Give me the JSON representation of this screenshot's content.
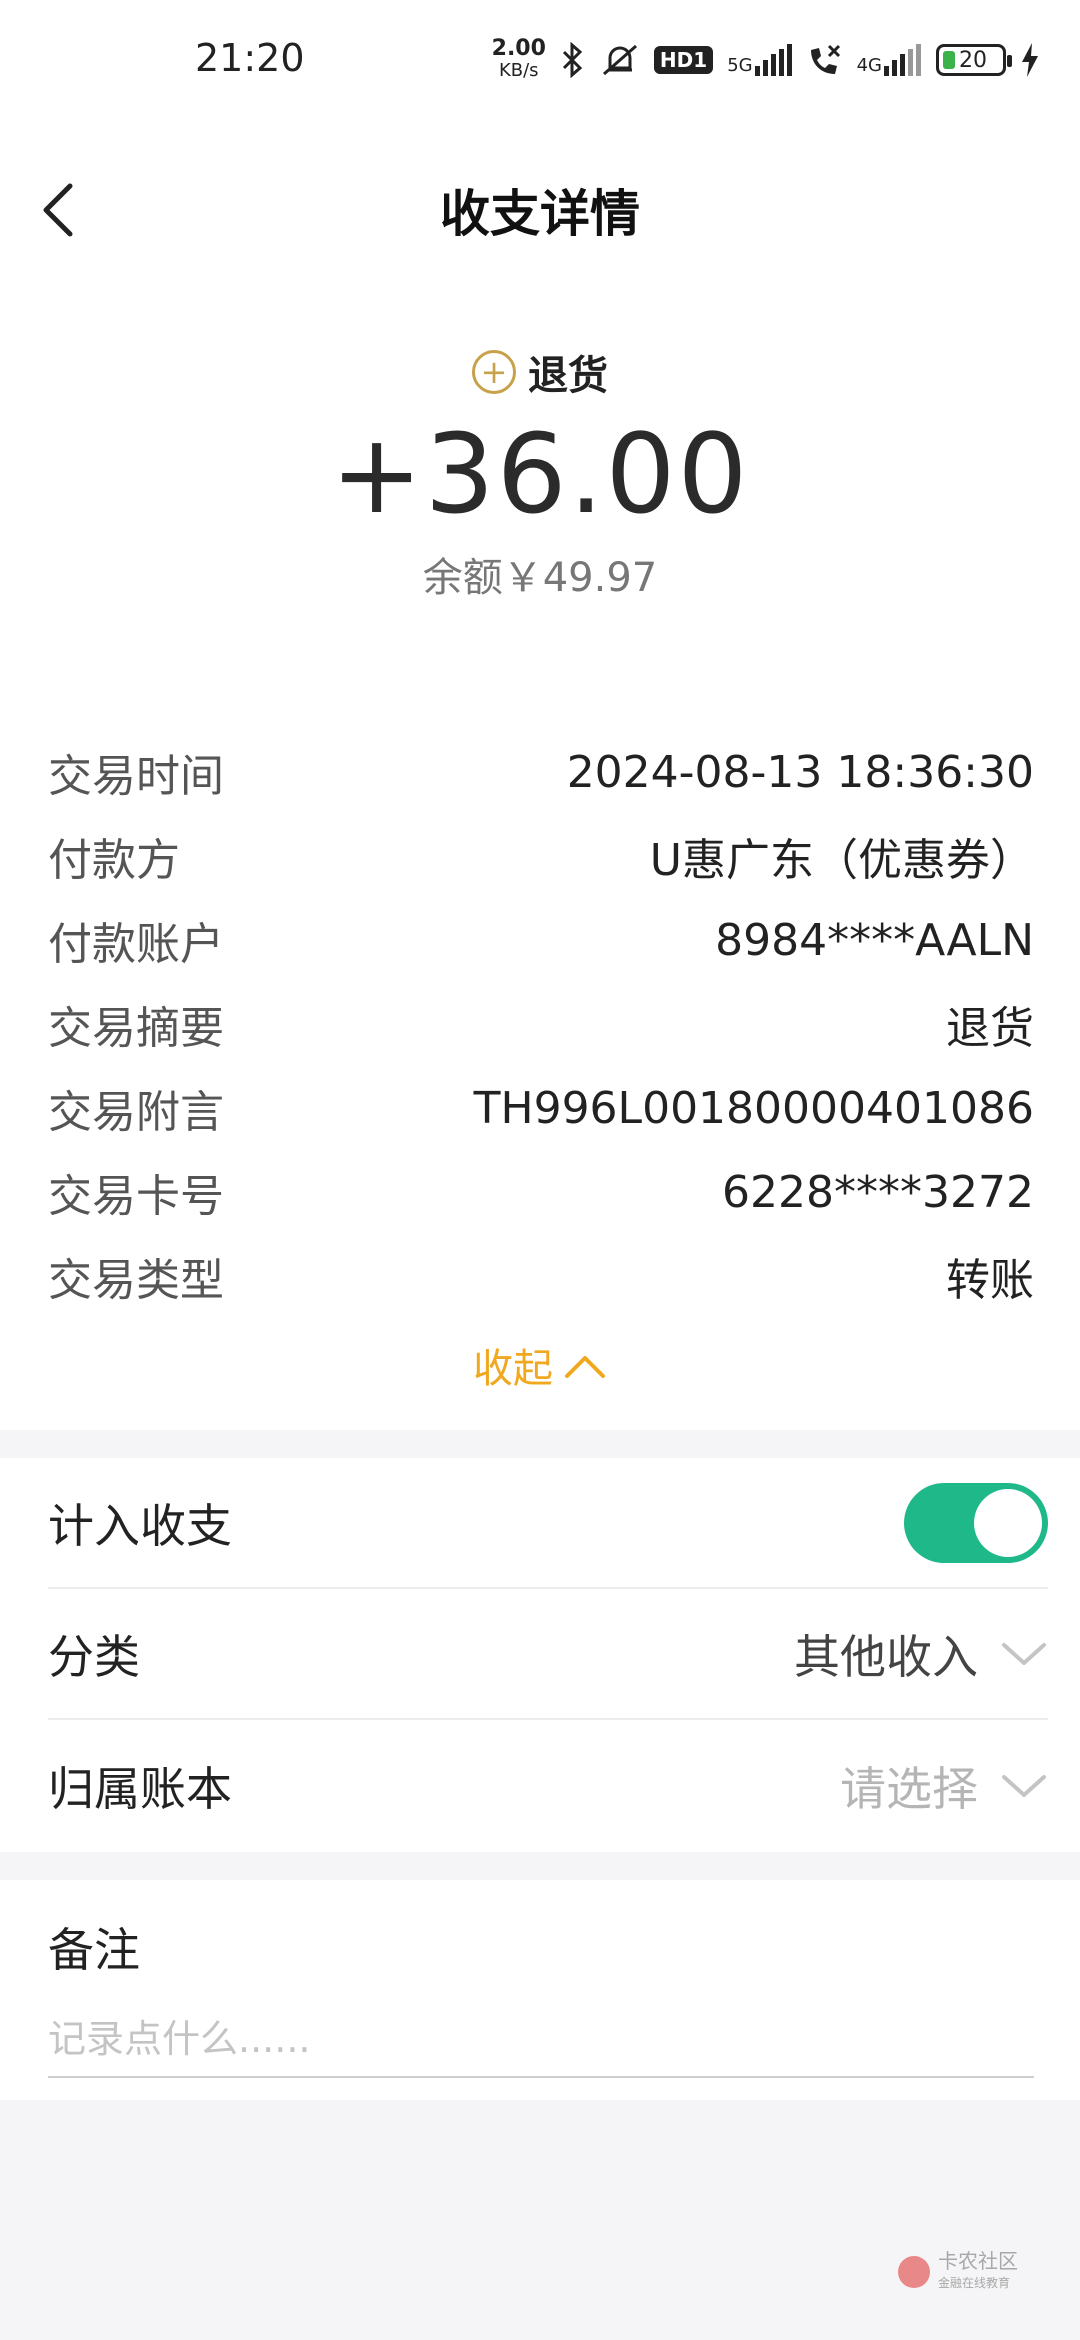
{
  "status_bar": {
    "time": "21:20",
    "net_speed_value": "2.00",
    "net_speed_unit": "KB/s",
    "hd_label": "HD1",
    "net1_label": "5G",
    "net2_label": "4G",
    "battery_level": "20"
  },
  "header": {
    "title": "收支详情"
  },
  "summary": {
    "type_label": "退货",
    "amount": "+36.00",
    "balance": "余额￥49.97"
  },
  "details": [
    {
      "label": "交易时间",
      "value": "2024-08-13 18:36:30"
    },
    {
      "label": "付款方",
      "value": "U惠广东（优惠券）"
    },
    {
      "label": "付款账户",
      "value": "8984****AALN"
    },
    {
      "label": "交易摘要",
      "value": "退货"
    },
    {
      "label": "交易附言",
      "value": "TH996L00180000401086"
    },
    {
      "label": "交易卡号",
      "value": "6228****3272"
    },
    {
      "label": "交易类型",
      "value": "转账"
    }
  ],
  "collapse_label": "收起",
  "settings": {
    "include": {
      "label": "计入收支",
      "enabled": true
    },
    "category": {
      "label": "分类",
      "value": "其他收入"
    },
    "ledger": {
      "label": "归属账本",
      "placeholder": "请选择"
    }
  },
  "notes": {
    "title": "备注",
    "placeholder": "记录点什么......"
  },
  "watermark": {
    "title": "卡农社区",
    "subtitle": "金融在线教育"
  },
  "colors": {
    "accent": "#f0a81e",
    "toggle_on": "#1fb889",
    "type_icon": "#c8a14b"
  }
}
